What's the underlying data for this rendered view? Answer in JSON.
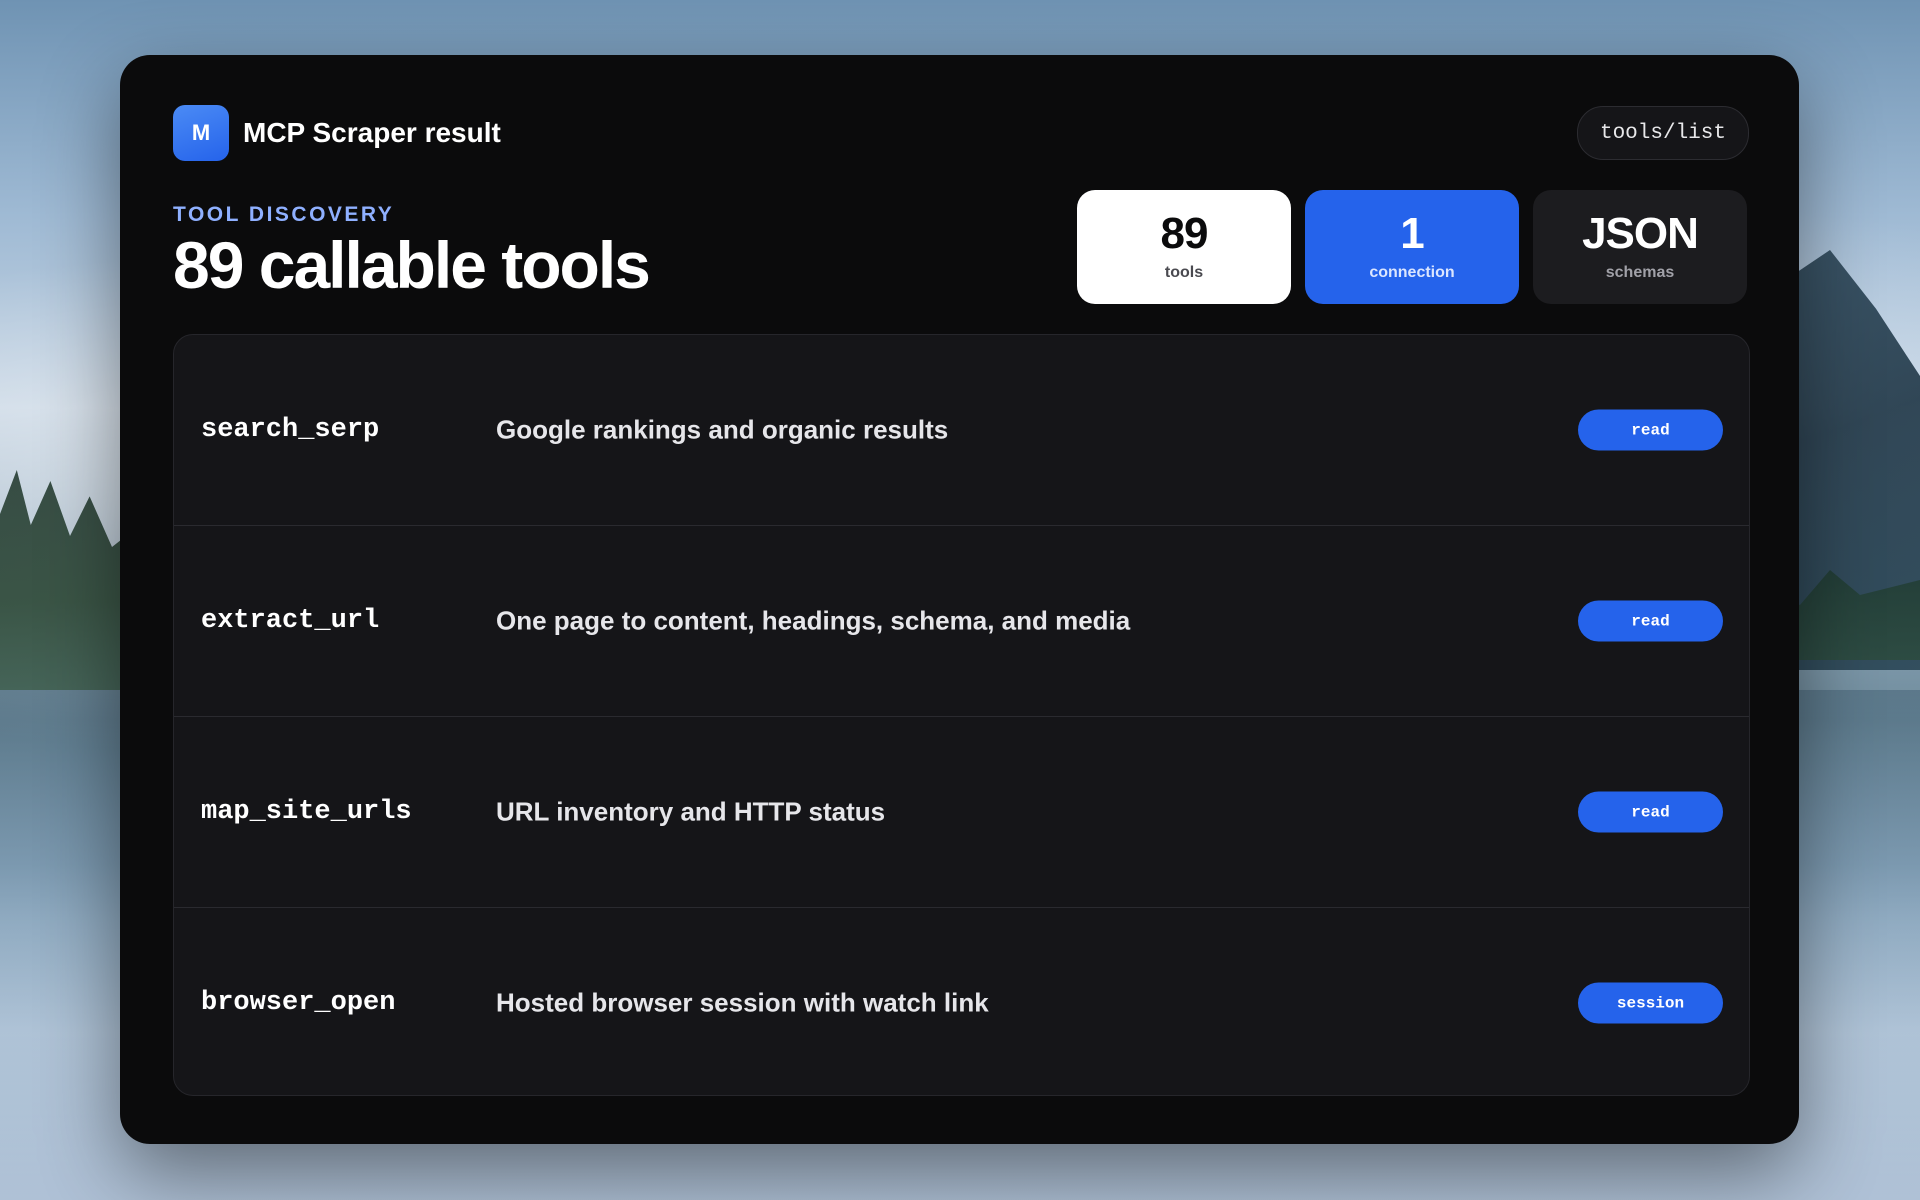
{
  "app": {
    "logo_letter": "M",
    "title": "MCP Scraper result",
    "endpoint": "tools/list"
  },
  "hero": {
    "eyebrow": "TOOL DISCOVERY",
    "headline": "89 callable tools"
  },
  "stats": [
    {
      "value": "89",
      "label": "tools",
      "style": "white"
    },
    {
      "value": "1",
      "label": "connection",
      "style": "blue"
    },
    {
      "value": "JSON",
      "label": "schemas",
      "style": "dark"
    }
  ],
  "tools": [
    {
      "name": "search_serp",
      "description": "Google rankings and organic results",
      "tag": "read"
    },
    {
      "name": "extract_url",
      "description": "One page to content, headings, schema, and media",
      "tag": "read"
    },
    {
      "name": "map_site_urls",
      "description": "URL inventory and HTTP status",
      "tag": "read"
    },
    {
      "name": "browser_open",
      "description": "Hosted browser session with watch link",
      "tag": "session"
    }
  ],
  "colors": {
    "accent": "#2563eb",
    "eyebrow": "#8fb0ff",
    "card_bg": "#0b0b0c",
    "table_bg": "#151518"
  }
}
